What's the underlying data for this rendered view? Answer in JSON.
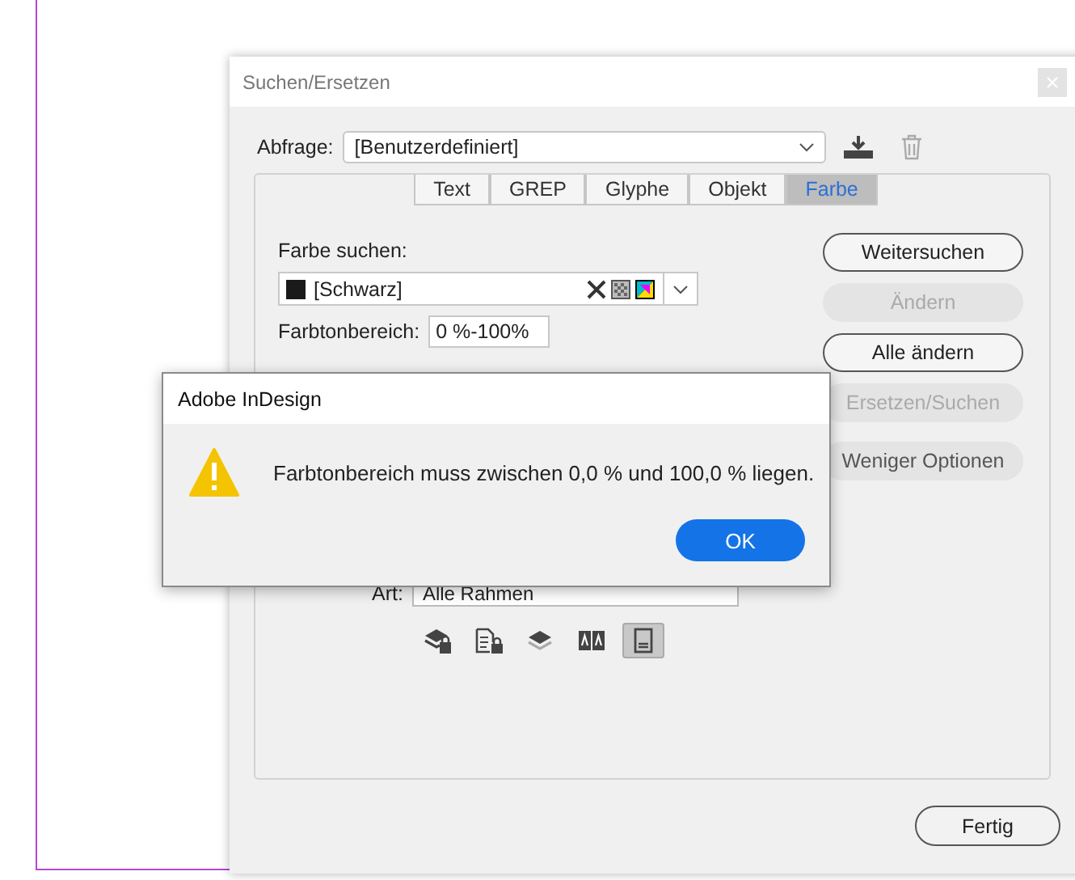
{
  "dialog": {
    "title": "Suchen/Ersetzen",
    "query_label": "Abfrage:",
    "query_value": "[Benutzerdefiniert]",
    "tabs": [
      {
        "label": "Text",
        "selected": false
      },
      {
        "label": "GREP",
        "selected": false
      },
      {
        "label": "Glyphe",
        "selected": false
      },
      {
        "label": "Objekt",
        "selected": false
      },
      {
        "label": "Farbe",
        "selected": true
      }
    ],
    "find_color_label": "Farbe suchen:",
    "find_color_value": "[Schwarz]",
    "tint_label": "Farbtonbereich:",
    "tint_value": "0 %-100%",
    "buttons": [
      {
        "label": "Weitersuchen",
        "kind": "outline",
        "disabled": false
      },
      {
        "label": "Ändern",
        "kind": "filled",
        "disabled": true
      },
      {
        "label": "Alle ändern",
        "kind": "outline",
        "disabled": false
      },
      {
        "label": "Ersetzen/Suchen",
        "kind": "filled",
        "disabled": true
      },
      {
        "label": "Weniger Optionen",
        "kind": "filled",
        "disabled": false
      }
    ],
    "type_label": "Art:",
    "type_value": "Alle Rahmen",
    "search_options": [
      {
        "kind": "locked-layers",
        "selected": false
      },
      {
        "kind": "locked-stories",
        "selected": false
      },
      {
        "kind": "hidden-layers",
        "selected": false
      },
      {
        "kind": "master-pages",
        "selected": false
      },
      {
        "kind": "footnotes",
        "selected": true
      }
    ],
    "done_button": "Fertig"
  },
  "alert": {
    "title": "Adobe InDesign",
    "message": "Farbtonbereich muss zwischen 0,0 % und 100,0 % liegen.",
    "ok_button": "OK"
  }
}
